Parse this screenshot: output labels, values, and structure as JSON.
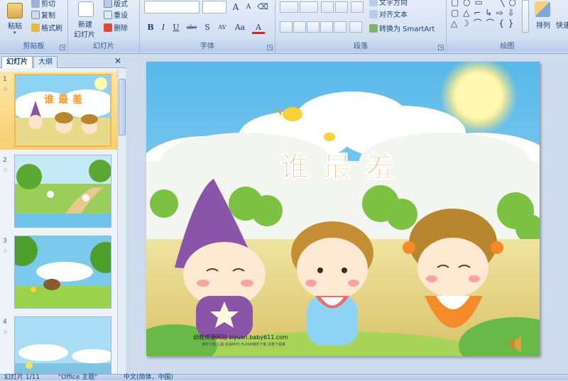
{
  "ribbon": {
    "clipboard": {
      "paste": "粘贴",
      "cut": "剪切",
      "copy": "复制",
      "format_painter": "格式刷",
      "label": "剪贴板"
    },
    "slides": {
      "new_slide": "新建",
      "new_slide2": "幻灯片",
      "layout": "版式",
      "reset": "重设",
      "delete": "删除",
      "label": "幻灯片"
    },
    "font": {
      "label": "字体",
      "grow": "A",
      "shrink": "A",
      "bold": "B",
      "italic": "I",
      "underline": "U",
      "strike": "abc",
      "shadow": "S",
      "spacing": "AV",
      "case": "Aa",
      "color": "A"
    },
    "paragraph": {
      "label": "段落",
      "text_direction": "文字方向",
      "align_text": "对齐文本",
      "smartart": "转换为 SmartArt"
    },
    "drawing": {
      "label": "绘图",
      "arrange": "排列",
      "quick_styles": "快速"
    }
  },
  "pane": {
    "tab_slides": "幻灯片",
    "tab_outline": "大纲",
    "close": "✕",
    "thumbnails": [
      {
        "num": "1",
        "title": "谁最羞",
        "selected": true
      },
      {
        "num": "2",
        "selected": false
      },
      {
        "num": "3",
        "selected": false
      },
      {
        "num": "4",
        "selected": false
      }
    ]
  },
  "slide": {
    "title": "谁最羞",
    "footer": "幼教资源网站  ziyuan.baby611.com",
    "footer_sub": "课件下载  儿歌  故事MP3  FLASH课件下载  试卷下载等"
  },
  "status": {
    "slide_count": "幻灯片 1/11",
    "theme": "\"Office 主题\"",
    "lang": "中文(简体，中国)"
  },
  "colors": {
    "title": "#f39a2a",
    "sky": "#6cc8f0",
    "grass": "#8cc63f",
    "gnome_hat": "#8a55a8"
  }
}
